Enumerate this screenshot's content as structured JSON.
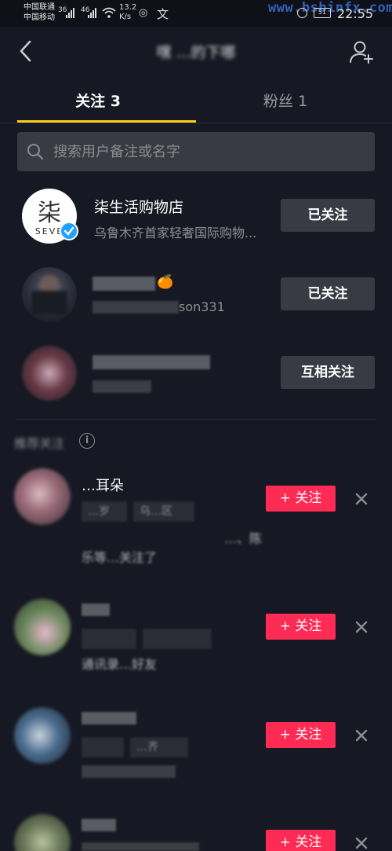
{
  "status_bar": {
    "carrier_1": "中国联通",
    "carrier_2": "中国移动",
    "sig_1": "36",
    "sig_2": "46",
    "speed_top": "13.2",
    "speed_bottom": "K/s",
    "wen": "文",
    "watermark": "www.bsbinfx.com",
    "battery": "51",
    "time": "22:55"
  },
  "header": {
    "title": "嘿 …的下哪"
  },
  "tabs": [
    {
      "label": "关注 3",
      "active": true
    },
    {
      "label": "粉丝 1",
      "active": false
    }
  ],
  "search": {
    "placeholder": "搜索用户备注或名字"
  },
  "following": [
    {
      "name": "柒生活购物店",
      "desc": "乌鲁木齐首家轻奢国际购物...",
      "button": "已关注",
      "avatar_text": "柒",
      "avatar_sub": "SEVE",
      "verified": true
    },
    {
      "name": "…生🍊",
      "desc": "…son331",
      "button": "已关注"
    },
    {
      "name": "",
      "desc": "",
      "button": "互相关注"
    }
  ],
  "recommend": {
    "label": "推荐关注",
    "items": [
      {
        "name": "…耳朵",
        "tags": [
          "…岁",
          "乌…区"
        ],
        "desc_line1": "…、陈",
        "desc_line2": "乐等…关注了",
        "button": "+ 关注"
      },
      {
        "name": "",
        "tags": [
          "",
          ""
        ],
        "desc_line1": "通讯录…好友",
        "desc_line2": "",
        "button": "+ 关注"
      },
      {
        "name": "",
        "tags": [
          "",
          "…齐"
        ],
        "desc_line1": "",
        "desc_line2": "",
        "button": "+ 关注"
      },
      {
        "name": "",
        "tags": [],
        "desc_line1": "",
        "desc_line2": "",
        "button": "+ 关注"
      }
    ]
  },
  "colors": {
    "background": "#161823",
    "accent_yellow": "#face15",
    "follow_red": "#fe2c55",
    "button_gray": "#393b44"
  }
}
